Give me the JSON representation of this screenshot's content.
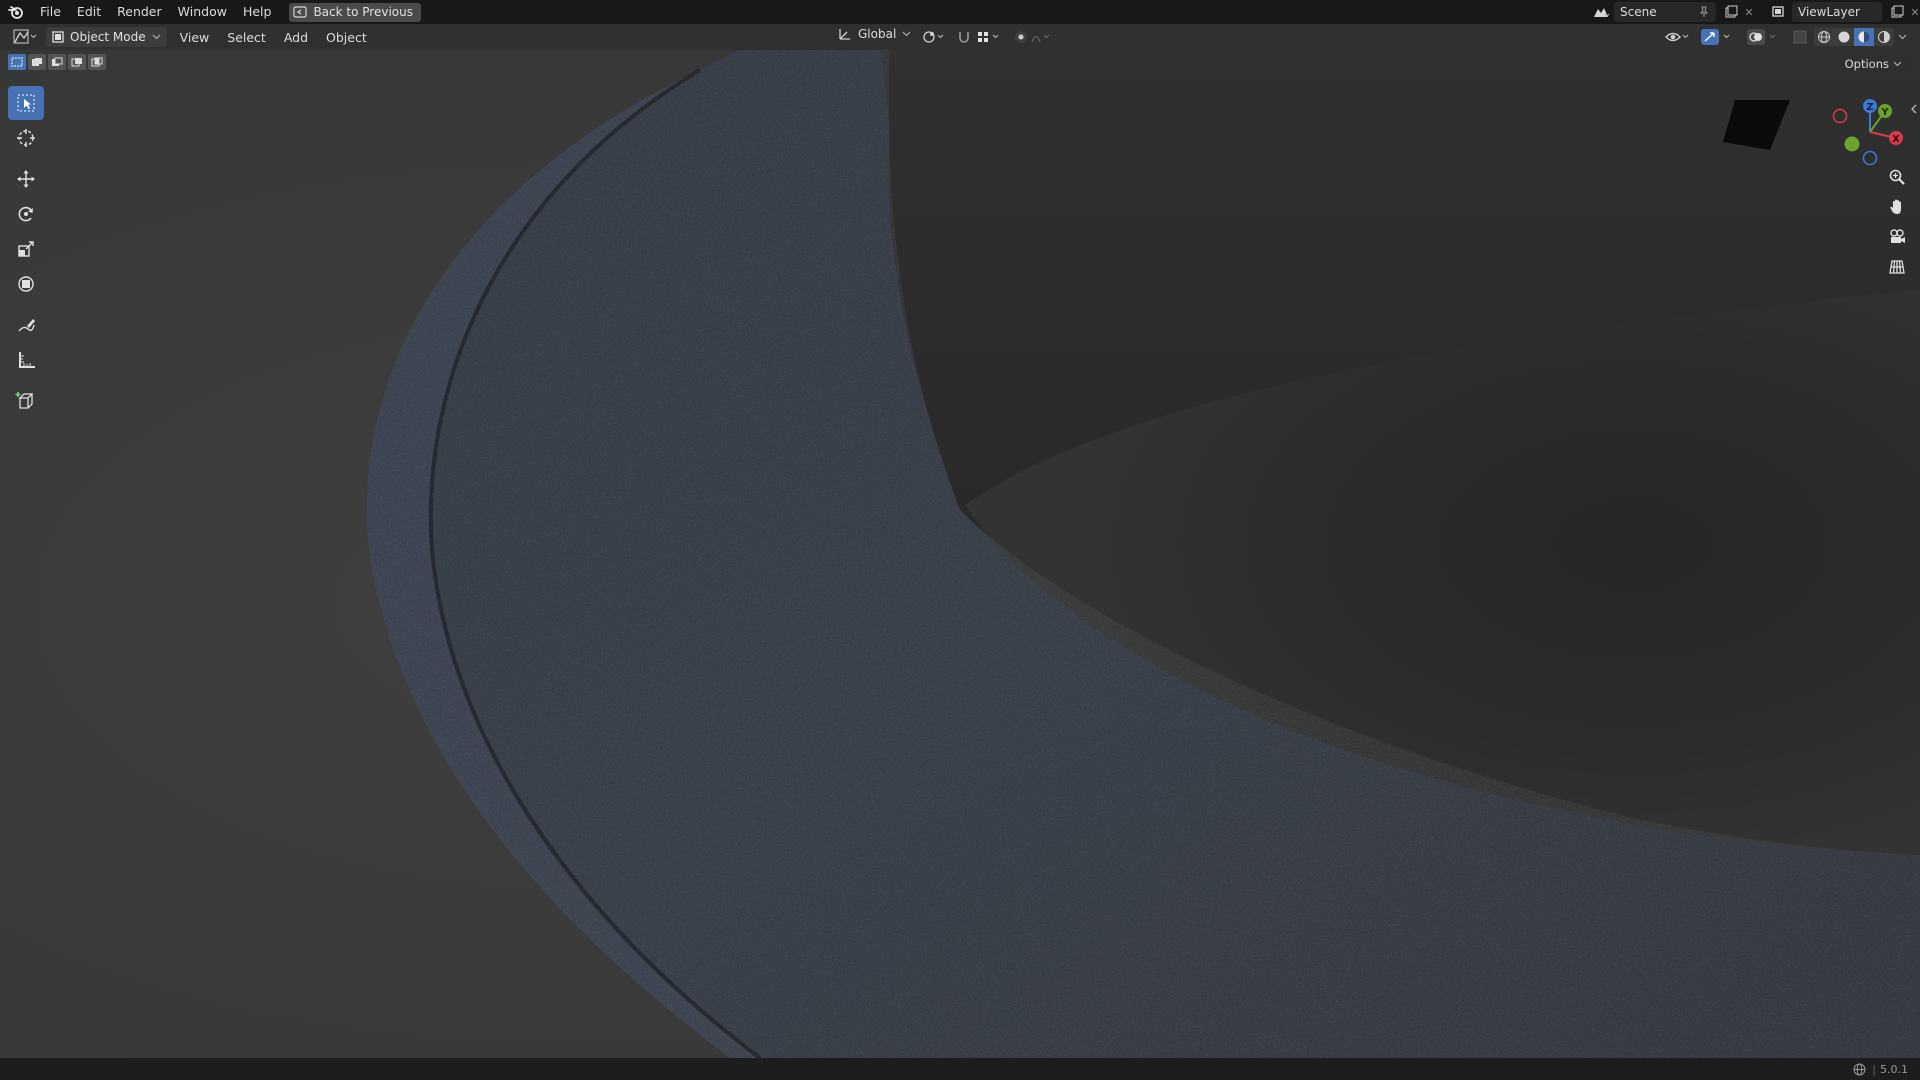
{
  "topbar": {
    "menus": [
      "File",
      "Edit",
      "Render",
      "Window",
      "Help"
    ],
    "back_button": "Back to Previous",
    "scene": "Scene",
    "view_layer": "ViewLayer"
  },
  "header": {
    "mode": "Object Mode",
    "menus": [
      "View",
      "Select",
      "Add",
      "Object"
    ],
    "orientation": "Global"
  },
  "viewport": {
    "options_label": "Options",
    "gizmo_axes": [
      "Z",
      "Y",
      "X"
    ]
  },
  "toolbar": {
    "tools": [
      "select-box-tool",
      "cursor-tool",
      "move-tool",
      "rotate-tool",
      "scale-tool",
      "transform-tool",
      "annotate-tool",
      "measure-tool",
      "add-cube-tool"
    ],
    "active": "select-box-tool"
  },
  "status": {
    "version": "5.0.1"
  },
  "colors": {
    "accent": "#4772b3",
    "topbar": "#181818",
    "header": "#303030",
    "viewport_bg": "#3b3b3b",
    "object": "#2a2f37"
  }
}
